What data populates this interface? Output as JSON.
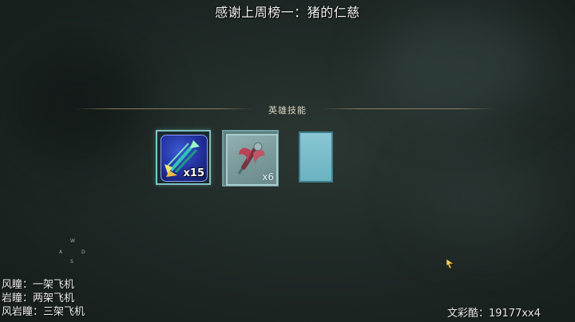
{
  "banner": {
    "text": "感谢上周榜一：猪的仁慈"
  },
  "section": {
    "title": "英雄技能"
  },
  "skills": [
    {
      "icon": "arrow-barrage-icon",
      "count": "x15"
    },
    {
      "icon": "feather-quill-icon",
      "count": "x6"
    },
    {
      "icon": "empty-slot-icon"
    }
  ],
  "compass": {
    "w": "W",
    "a": "A",
    "d": "D",
    "s": "S"
  },
  "notes": [
    "风瞳：一架飞机",
    "岩瞳：两架飞机",
    "风岩瞳：三架飞机"
  ],
  "bottom_right": "文彩酷：19177xx4"
}
